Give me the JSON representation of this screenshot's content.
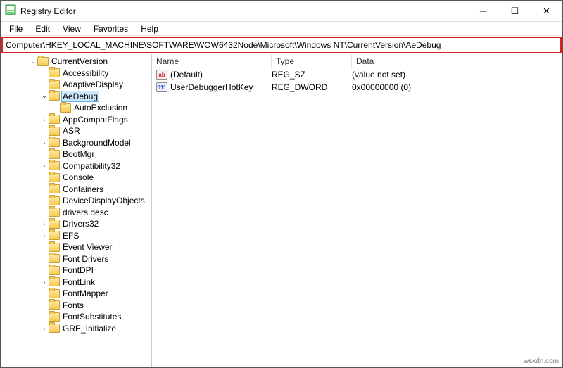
{
  "title": "Registry Editor",
  "menu": [
    "File",
    "Edit",
    "View",
    "Favorites",
    "Help"
  ],
  "address": "Computer\\HKEY_LOCAL_MACHINE\\SOFTWARE\\WOW6432Node\\Microsoft\\Windows NT\\CurrentVersion\\AeDebug",
  "columns": {
    "name": "Name",
    "type": "Type",
    "data": "Data"
  },
  "tree": [
    {
      "indent": 40,
      "chevron": "expanded",
      "label": "CurrentVersion",
      "selected": false
    },
    {
      "indent": 56,
      "chevron": "",
      "label": "Accessibility"
    },
    {
      "indent": 56,
      "chevron": "",
      "label": "AdaptiveDisplay"
    },
    {
      "indent": 56,
      "chevron": "expanded",
      "label": "AeDebug",
      "selected": true
    },
    {
      "indent": 72,
      "chevron": "",
      "label": "AutoExclusion"
    },
    {
      "indent": 56,
      "chevron": "collapsed",
      "label": "AppCompatFlags"
    },
    {
      "indent": 56,
      "chevron": "",
      "label": "ASR"
    },
    {
      "indent": 56,
      "chevron": "collapsed",
      "label": "BackgroundModel"
    },
    {
      "indent": 56,
      "chevron": "",
      "label": "BootMgr"
    },
    {
      "indent": 56,
      "chevron": "collapsed",
      "label": "Compatibility32"
    },
    {
      "indent": 56,
      "chevron": "",
      "label": "Console"
    },
    {
      "indent": 56,
      "chevron": "",
      "label": "Containers"
    },
    {
      "indent": 56,
      "chevron": "",
      "label": "DeviceDisplayObjects"
    },
    {
      "indent": 56,
      "chevron": "",
      "label": "drivers.desc"
    },
    {
      "indent": 56,
      "chevron": "collapsed",
      "label": "Drivers32"
    },
    {
      "indent": 56,
      "chevron": "collapsed",
      "label": "EFS"
    },
    {
      "indent": 56,
      "chevron": "",
      "label": "Event Viewer"
    },
    {
      "indent": 56,
      "chevron": "",
      "label": "Font Drivers"
    },
    {
      "indent": 56,
      "chevron": "",
      "label": "FontDPI"
    },
    {
      "indent": 56,
      "chevron": "collapsed",
      "label": "FontLink"
    },
    {
      "indent": 56,
      "chevron": "",
      "label": "FontMapper"
    },
    {
      "indent": 56,
      "chevron": "",
      "label": "Fonts"
    },
    {
      "indent": 56,
      "chevron": "",
      "label": "FontSubstitutes"
    },
    {
      "indent": 56,
      "chevron": "collapsed",
      "label": "GRE_Initialize"
    }
  ],
  "values": [
    {
      "icon": "sz",
      "iconText": "ab",
      "name": "(Default)",
      "type": "REG_SZ",
      "data": "(value not set)"
    },
    {
      "icon": "dw",
      "iconText": "011",
      "name": "UserDebuggerHotKey",
      "type": "REG_DWORD",
      "data": "0x00000000 (0)"
    }
  ],
  "watermark": "wsxdn.com"
}
